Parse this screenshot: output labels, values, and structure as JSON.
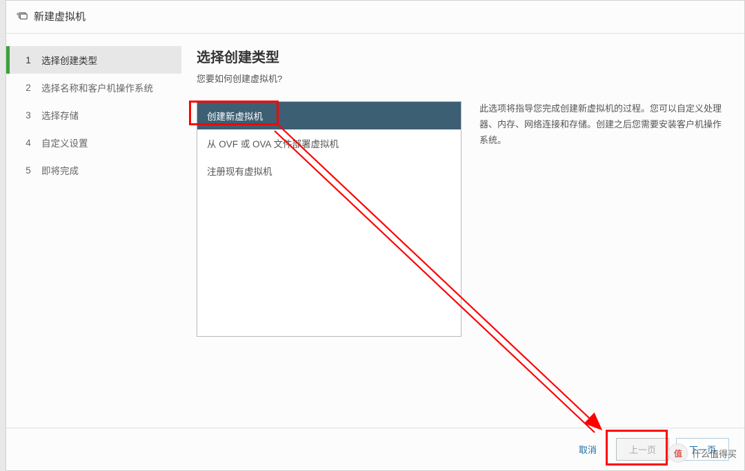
{
  "dialog": {
    "title": "新建虚拟机"
  },
  "steps": [
    {
      "num": "1",
      "label": "选择创建类型",
      "active": true
    },
    {
      "num": "2",
      "label": "选择名称和客户机操作系统",
      "active": false
    },
    {
      "num": "3",
      "label": "选择存储",
      "active": false
    },
    {
      "num": "4",
      "label": "自定义设置",
      "active": false
    },
    {
      "num": "5",
      "label": "即将完成",
      "active": false
    }
  ],
  "content": {
    "title": "选择创建类型",
    "subtitle": "您要如何创建虚拟机?"
  },
  "options": [
    {
      "label": "创建新虚拟机",
      "selected": true
    },
    {
      "label": "从 OVF 或 OVA 文件部署虚拟机",
      "selected": false
    },
    {
      "label": "注册现有虚拟机",
      "selected": false
    }
  ],
  "description": "此选项将指导您完成创建新虚拟机的过程。您可以自定义处理器、内存、网络连接和存储。创建之后您需要安装客户机操作系统。",
  "footer": {
    "cancel": "取消",
    "prev": "上一页",
    "next": "下一页"
  },
  "watermark": {
    "badge": "值",
    "text": "什么值得买"
  }
}
